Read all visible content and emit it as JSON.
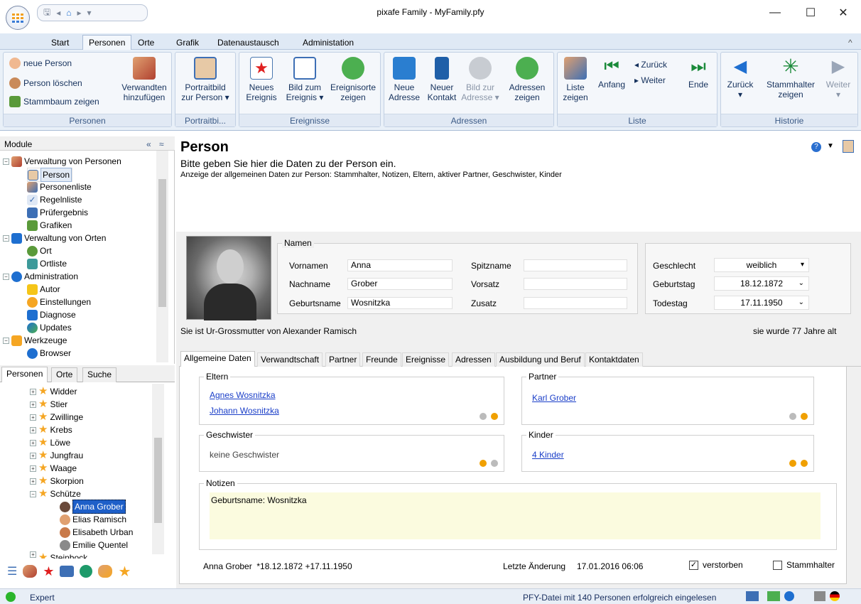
{
  "window": {
    "title": "pixafe Family - MyFamily.pfy",
    "minimize": "—",
    "maximize": "☐",
    "close": "✕"
  },
  "qat": {
    "save": "🖫",
    "back": "◂",
    "home": "⌂",
    "fwd": "▸",
    "more": "▾"
  },
  "ribbon_tabs": [
    "Start",
    "Personen",
    "Orte",
    "Grafik",
    "Datenaustausch",
    "Administation"
  ],
  "ribbon_collapse": "^",
  "groups": {
    "personen": {
      "caption": "Personen",
      "new_person": "neue Person",
      "delete_person": "Person löschen",
      "show_tree": "Stammbaum zeigen",
      "add_relatives_1": "Verwandten",
      "add_relatives_2": "hinzufügen"
    },
    "portrait": {
      "caption": "Portraitbi...",
      "btn_1": "Portraitbild",
      "btn_2": "zur Person ▾"
    },
    "ereignisse": {
      "caption": "Ereignisse",
      "new_event_1": "Neues",
      "new_event_2": "Ereignis",
      "pic_event_1": "Bild zum",
      "pic_event_2": "Ereignis ▾",
      "places_1": "Ereignisorte",
      "places_2": "zeigen"
    },
    "adressen": {
      "caption": "Adressen",
      "new_addr_1": "Neue",
      "new_addr_2": "Adresse",
      "new_contact_1": "Neuer",
      "new_contact_2": "Kontakt",
      "pic_addr_1": "Bild zur",
      "pic_addr_2": "Adresse ▾",
      "show_addr_1": "Adressen",
      "show_addr_2": "zeigen"
    },
    "liste": {
      "caption": "Liste",
      "show_1": "Liste",
      "show_2": "zeigen",
      "start": "Anfang",
      "back": "◂ Zurück",
      "next": "▸ Weiter",
      "end": "Ende"
    },
    "historie": {
      "caption": "Historie",
      "back": "Zurück",
      "back_arrow": "▾",
      "stamm_1": "Stammhalter",
      "stamm_2": "zeigen",
      "next": "Weiter",
      "next_arrow": "▾"
    }
  },
  "modules": {
    "header": "Module",
    "collapse": "«",
    "pin": "≈",
    "items": [
      "Verwaltung von Personen",
      "Person",
      "Personenliste",
      "Regelnliste",
      "Prüfergebnis",
      "Grafiken",
      "Verwaltung von Orten",
      "Ort",
      "Ortliste",
      "Administration",
      "Autor",
      "Einstellungen",
      "Diagnose",
      "Updates",
      "Werkzeuge",
      "Browser"
    ]
  },
  "bottom_tabs": [
    "Personen",
    "Orte",
    "Suche"
  ],
  "person_tree": {
    "items": [
      "Widder",
      "Stier",
      "Zwillinge",
      "Krebs",
      "Löwe",
      "Jungfrau",
      "Waage",
      "Skorpion",
      "Schütze",
      "Anna Grober",
      "Elias Ramisch",
      "Elisabeth Urban",
      "Emilie Quentel",
      "Steinbock"
    ]
  },
  "page": {
    "title": "Person",
    "subtitle": "Bitte geben Sie hier die Daten zu der Person ein.",
    "description": "Anzeige der allgemeinen Daten zur Person: Stammhalter, Notizen, Eltern, aktiver Partner, Geschwister, Kinder"
  },
  "names": {
    "legend": "Namen",
    "first_label": "Vornamen",
    "first": "Anna",
    "last_label": "Nachname",
    "last": "Grober",
    "birth_label": "Geburtsname",
    "birth": "Wosnitzka",
    "nick_label": "Spitzname",
    "nick": "",
    "prefix_label": "Vorsatz",
    "prefix": "",
    "suffix_label": "Zusatz",
    "suffix": ""
  },
  "details": {
    "gender_label": "Geschlecht",
    "gender": "weiblich",
    "birthday_label": "Geburtstag",
    "birthday": "18.12.1872",
    "deathday_label": "Todestag",
    "deathday": "17.11.1950"
  },
  "relation": "Sie ist Ur-Grossmutter von Alexander Ramisch",
  "age": "sie wurde 77 Jahre alt",
  "person_tabs": [
    "Allgemeine Daten",
    "Verwandtschaft",
    "Partner",
    "Freunde",
    "Ereignisse",
    "Adressen",
    "Ausbildung und Beruf",
    "Kontaktdaten"
  ],
  "general": {
    "parents": {
      "legend": "Eltern",
      "items": [
        "Agnes Wosnitzka",
        "Johann Wosnitzka"
      ]
    },
    "partner": {
      "legend": "Partner",
      "items": [
        "Karl Grober"
      ]
    },
    "siblings": {
      "legend": "Geschwister",
      "text": "keine Geschwister"
    },
    "children": {
      "legend": "Kinder",
      "link": "4 Kinder"
    },
    "notes": {
      "legend": "Notizen",
      "text": "Geburtsname: Wosnitzka"
    }
  },
  "footer": {
    "summary": "Anna Grober  *18.12.1872 +17.11.1950",
    "last_change_label": "Letzte Änderung",
    "last_change": "17.01.2016 06:06",
    "deceased": "verstorben",
    "deceased_check": "✓",
    "stammhalter": "Stammhalter"
  },
  "status": {
    "mode": "Expert",
    "message": "PFY-Datei mit 140 Personen erfolgreich eingelesen"
  },
  "colors": {
    "accent": "#3b5a86",
    "link": "#1a3ec8",
    "notes_bg": "#fbfbdf",
    "star": "#f5a623"
  }
}
